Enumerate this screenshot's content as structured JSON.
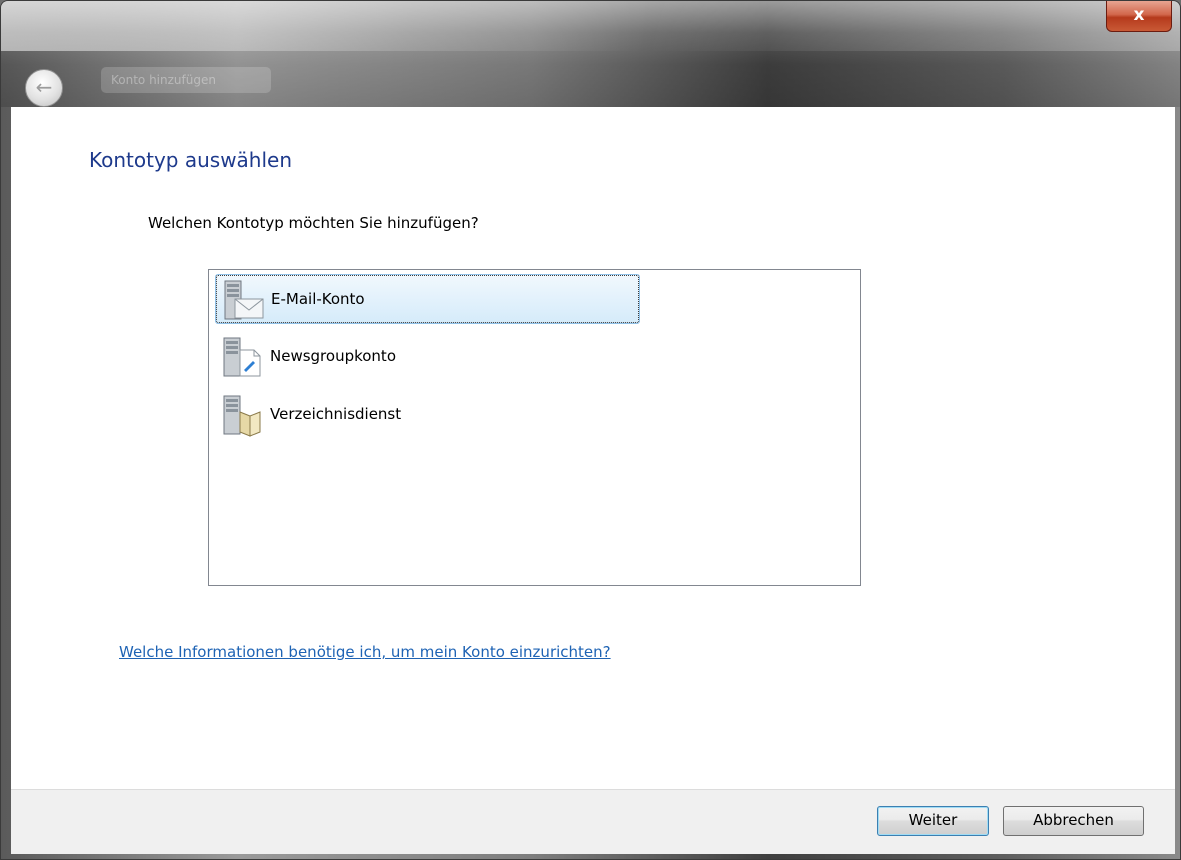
{
  "titlebar": {
    "close_label": "x",
    "back_icon": "back-arrow-icon",
    "blurred_title": "Konto hinzufügen"
  },
  "page": {
    "heading": "Kontotyp auswählen",
    "question": "Welchen Kontotyp möchten Sie hinzufügen?"
  },
  "list": {
    "items": [
      {
        "label": "E-Mail-Konto",
        "icon": "email-server-icon",
        "selected": true
      },
      {
        "label": "Newsgroupkonto",
        "icon": "newsgroup-server-icon",
        "selected": false
      },
      {
        "label": "Verzeichnisdienst",
        "icon": "directory-service-icon",
        "selected": false
      }
    ]
  },
  "help_link": "Welche Informationen benötige ich, um mein Konto einzurichten?",
  "buttons": {
    "next_label": "Weiter",
    "cancel_label": "Abbrechen"
  },
  "colors": {
    "heading": "#1e3a8c",
    "link": "#1e63b4",
    "selection": "#d5ebfa",
    "close_button": "#c95a36"
  }
}
